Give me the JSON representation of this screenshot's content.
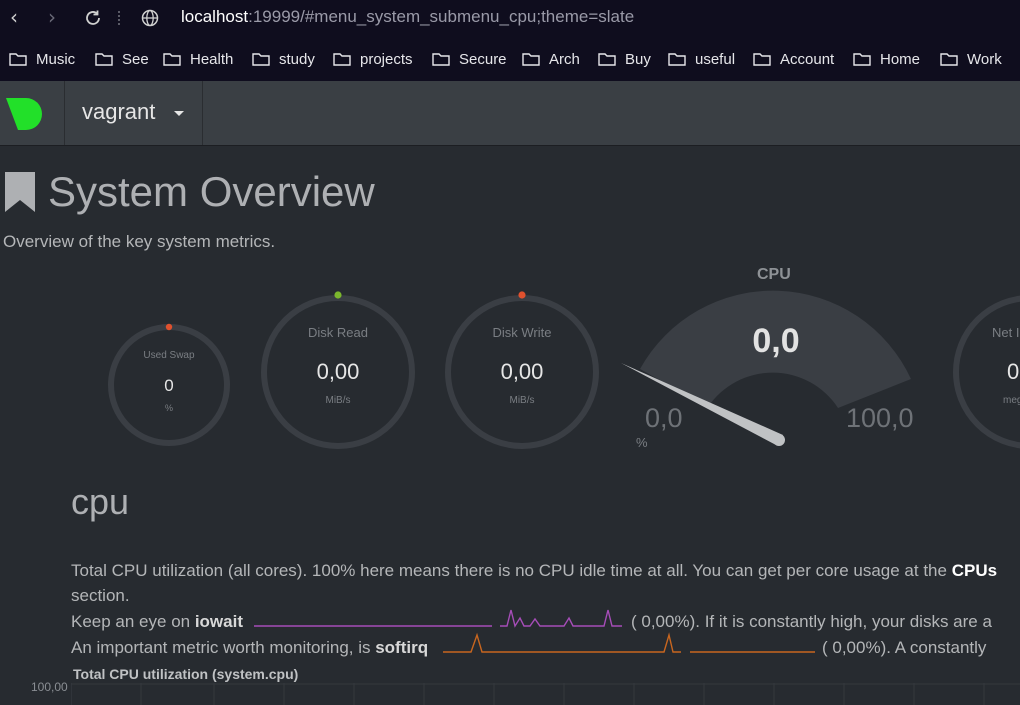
{
  "browser": {
    "url_host": "localhost",
    "url_rest": ":19999/#menu_system_submenu_cpu;theme=slate",
    "bookmarks": [
      "Music",
      "See",
      "Health",
      "study",
      "projects",
      "Secure",
      "Arch",
      "Buy",
      "useful",
      "Account",
      "Home",
      "Work"
    ]
  },
  "header": {
    "hostname": "vagrant",
    "logo_color": "#22e029"
  },
  "page": {
    "title": "System Overview",
    "subtitle": "Overview of the key system metrics."
  },
  "gauges": {
    "swap": {
      "label": "Used Swap",
      "value": "0",
      "unit": "%",
      "dot_color": "#e0512e"
    },
    "disk_read": {
      "label": "Disk Read",
      "value": "0,00",
      "unit": "MiB/s",
      "dot_color": "#7bb72d"
    },
    "disk_write": {
      "label": "Disk Write",
      "value": "0,00",
      "unit": "MiB/s",
      "dot_color": "#e0512e"
    },
    "cpu": {
      "title": "CPU",
      "value": "0,0",
      "min": "0,0",
      "max": "100,0",
      "unit": "%"
    },
    "net": {
      "label": "Net I",
      "value": "0",
      "unit": "meg"
    }
  },
  "section": {
    "heading": "cpu",
    "line1_a": "Total CPU utilization (all cores). 100% here means there is no CPU idle time at all. You can get per core usage at the ",
    "line1_b": "CPUs",
    "line2": "section.",
    "line3_a": "Keep an eye on ",
    "line3_b": "iowait",
    "line3_c": "(      0,00%). If it is constantly high, your disks are a",
    "line4_a": "An important metric worth monitoring, is ",
    "line4_b": "softirq",
    "line4_c": "(      0,00%). A constantly",
    "iowait_color": "#a64db8",
    "softirq_color": "#c8661f"
  },
  "chart": {
    "title": "Total CPU utilization (system.cpu)",
    "y_top": "100,00"
  }
}
